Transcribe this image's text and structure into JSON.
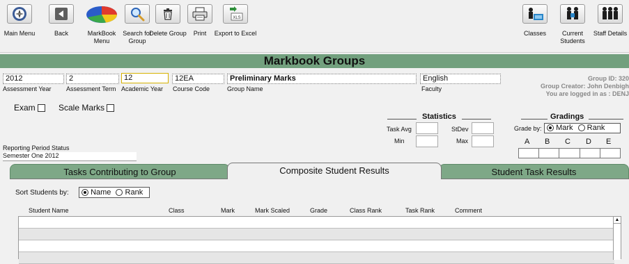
{
  "toolbar": {
    "left_buttons": [
      {
        "label": "Main Menu",
        "icon": "compass-icon"
      },
      {
        "label": "Back",
        "icon": "back-arrow-icon"
      },
      {
        "label": "MarkBook Menu",
        "icon": "pie-chart-icon"
      },
      {
        "label": "Search for Group",
        "icon": "search-icon"
      },
      {
        "label": "Delete Group",
        "icon": "trash-icon"
      },
      {
        "label": "Print",
        "icon": "printer-icon"
      },
      {
        "label": "Export to Excel",
        "icon": "xls-export-icon"
      }
    ],
    "right_buttons": [
      {
        "label": "Classes",
        "icon": "class-group-icon"
      },
      {
        "label": "Current Students",
        "icon": "students-icon"
      },
      {
        "label": "Staff Details",
        "icon": "staff-icon"
      }
    ],
    "xls_text": "XLS"
  },
  "title": "Markbook Groups",
  "fields": {
    "assessment_year": {
      "value": "2012",
      "caption": "Assessment Year"
    },
    "assessment_term": {
      "value": "2",
      "caption": "Assessment Term"
    },
    "academic_year": {
      "value": "12",
      "caption": "Academic Year"
    },
    "course_code": {
      "value": "12EA",
      "caption": "Course Code"
    },
    "group_name": {
      "value": "Preliminary Marks",
      "caption": "Group Name"
    },
    "faculty": {
      "value": "English",
      "caption": "Faculty"
    }
  },
  "info": {
    "group_id": "Group ID: 320",
    "creator": "Group Creator: John Denbigh",
    "logged_in": "You are logged in as : DENJ"
  },
  "options": {
    "exam_label": "Exam",
    "scale_label": "Scale Marks"
  },
  "statistics": {
    "heading": "Statistics",
    "task_avg": "Task Avg",
    "stdev": "StDev",
    "min": "Min",
    "max": "Max"
  },
  "reporting": {
    "caption": "Reporting Period Status",
    "value": "Semester One 2012"
  },
  "gradings": {
    "heading": "Gradings",
    "grade_by": "Grade by:",
    "mark": "Mark",
    "rank": "Rank",
    "letters": [
      "A",
      "B",
      "C",
      "D",
      "E"
    ]
  },
  "tabs": [
    "Tasks Contributing to Group",
    "Composite Student Results",
    "Student Task Results"
  ],
  "sort": {
    "label": "Sort Students by:",
    "name": "Name",
    "rank": "Rank"
  },
  "columns": [
    "Student Name",
    "Class",
    "Mark",
    "Mark Scaled",
    "Grade",
    "Class Rank",
    "Task Rank",
    "Comment"
  ],
  "colors": {
    "accent_green": "#72a07e",
    "tab_green": "#7ea887",
    "background": "#f1f1f1"
  }
}
